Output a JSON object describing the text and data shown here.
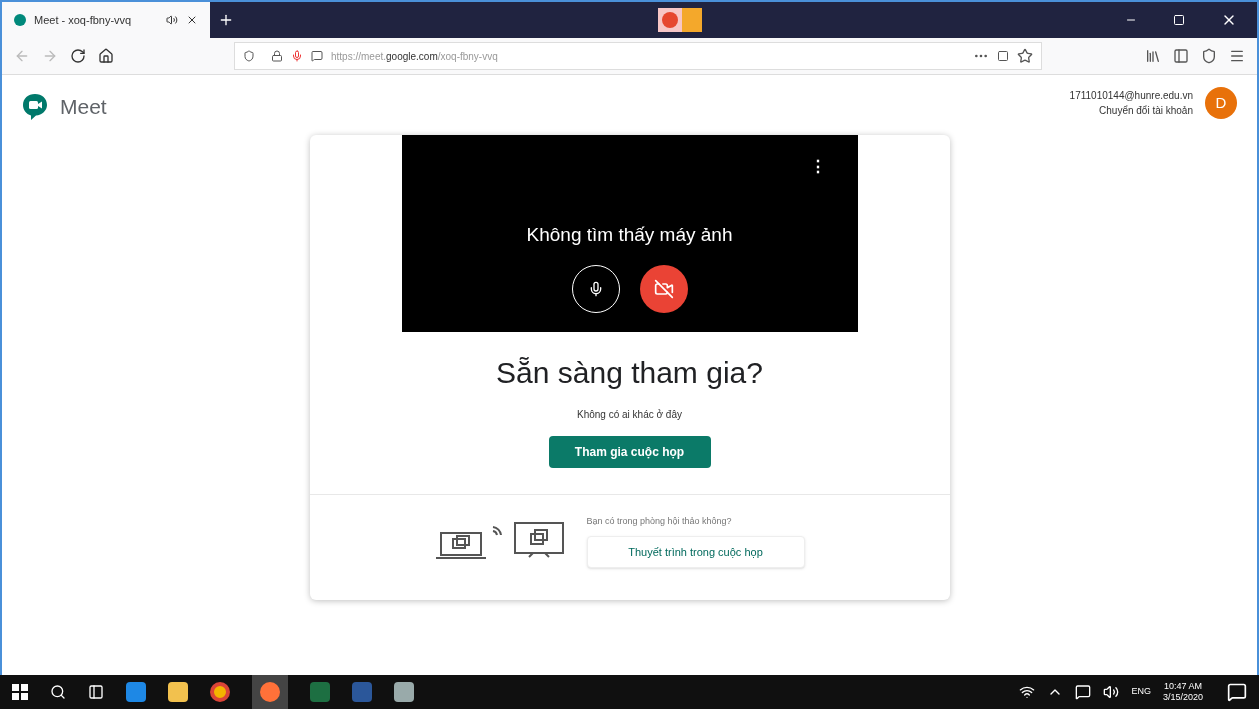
{
  "browser": {
    "tab": {
      "title": "Meet - xoq-fbny-vvq",
      "selected": true
    },
    "url_prefix": "https://meet.",
    "url_domain": "google.com",
    "url_path": "/xoq-fbny-vvq"
  },
  "app": {
    "name": "Meet"
  },
  "account": {
    "email": "1711010144@hunre.edu.vn",
    "switch_label": "Chuyển đổi tài khoản",
    "avatar_letter": "D"
  },
  "preview": {
    "message": "Không tìm thấy máy ảnh",
    "more": "⋮",
    "controls": [
      {
        "kind": "mic",
        "on": true
      },
      {
        "kind": "camera",
        "on": false
      }
    ]
  },
  "join": {
    "heading": "Sẵn sàng tham gia?",
    "status": "Không có ai khác ở đây",
    "button": "Tham gia cuộc họp"
  },
  "present": {
    "question": "Bạn có trong phòng hội thảo không?",
    "button": "Thuyết trình trong cuộc họp"
  },
  "taskbar": {
    "language": "ENG",
    "time": "10:47 AM",
    "date": "3/15/2020"
  }
}
